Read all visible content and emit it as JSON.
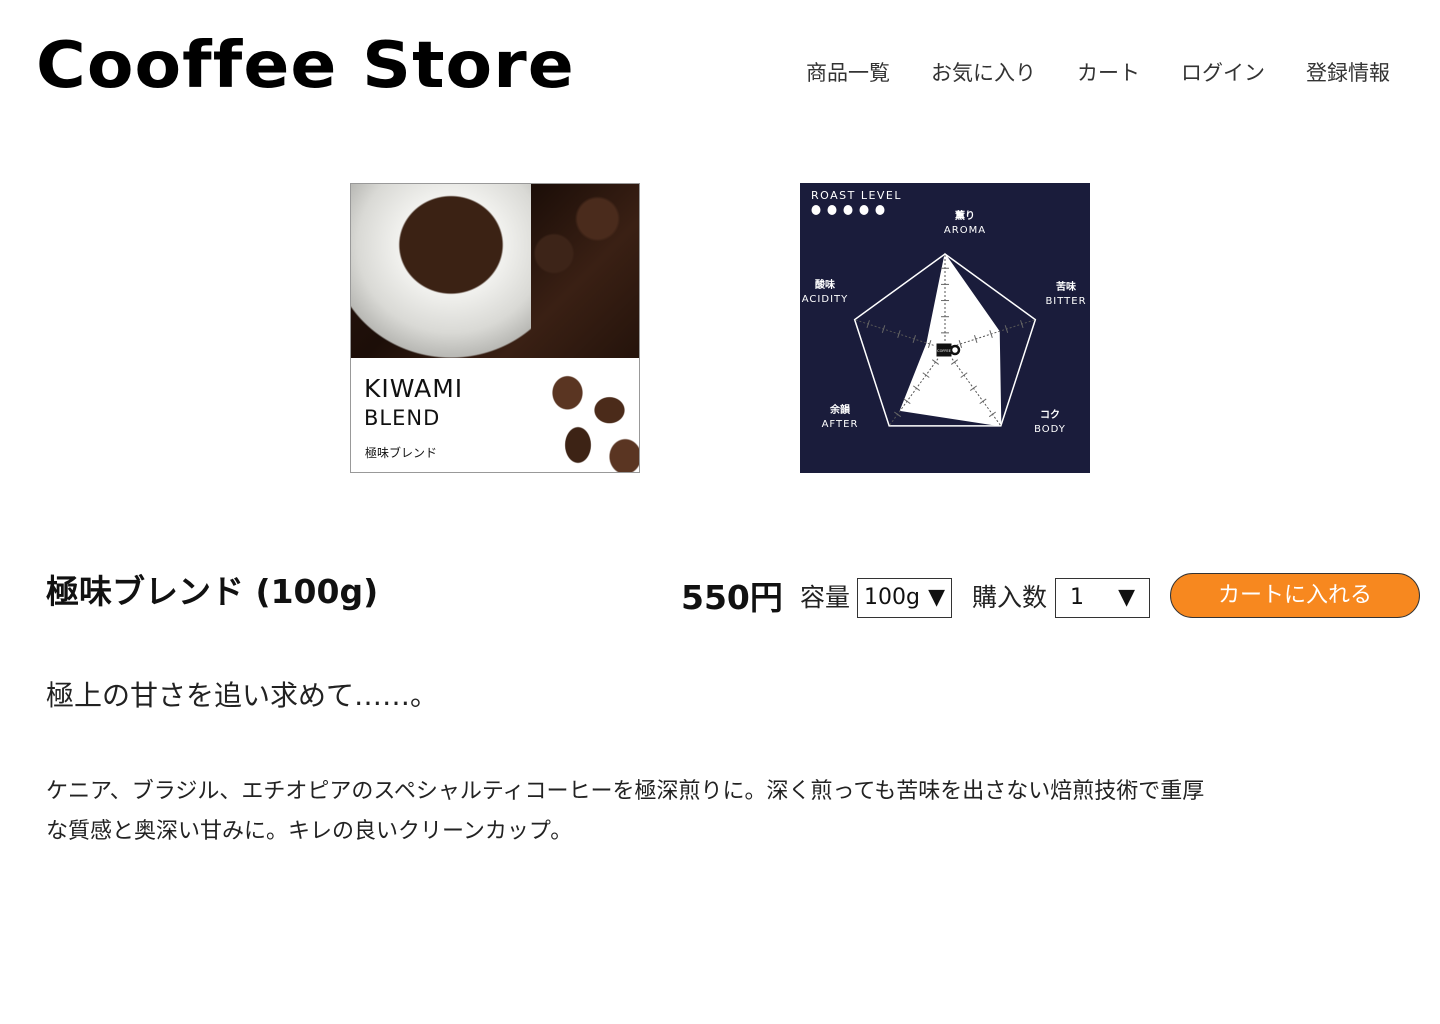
{
  "header": {
    "logo": "Cooffee Store",
    "nav": [
      "商品一覧",
      "お気に入り",
      "カート",
      "ログイン",
      "登録情報"
    ]
  },
  "product_image": {
    "title_line1": "KIWAMI",
    "title_line2": "BLEND",
    "title_ja": "極味ブレンド"
  },
  "flavor_chart": {
    "roast_level_label": "ROAST LEVEL",
    "roast_level": "5 of 5",
    "center_label": "COFFEE",
    "axes": [
      {
        "ja": "薫り",
        "en": "AROMA"
      },
      {
        "ja": "苦味",
        "en": "BITTER"
      },
      {
        "ja": "コク",
        "en": "BODY"
      },
      {
        "ja": "余韻",
        "en": "AFTER"
      },
      {
        "ja": "酸味",
        "en": "ACIDITY"
      }
    ],
    "values": [
      5,
      3,
      5,
      4,
      1
    ],
    "max": 5,
    "colors": {
      "background": "#1a1c3b",
      "fill": "#ffffff"
    }
  },
  "product": {
    "name": "極味ブレンド (100g)",
    "price": "550円",
    "capacity_label": "容量",
    "capacity_value": "100g",
    "quantity_label": "購入数",
    "quantity_value": "1",
    "add_to_cart": "カートに入れる",
    "catchphrase": "極上の甘さを追い求めて……。",
    "description": "ケニア、ブラジル、エチオピアのスペシャルティコーヒーを極深煎りに。深く煎っても苦味を出さない焙煎技術で重厚な質感と奥深い甘みに。キレの良いクリーンカップ。"
  },
  "colors": {
    "accent": "#f7881f",
    "chart_bg": "#1a1c3b"
  }
}
